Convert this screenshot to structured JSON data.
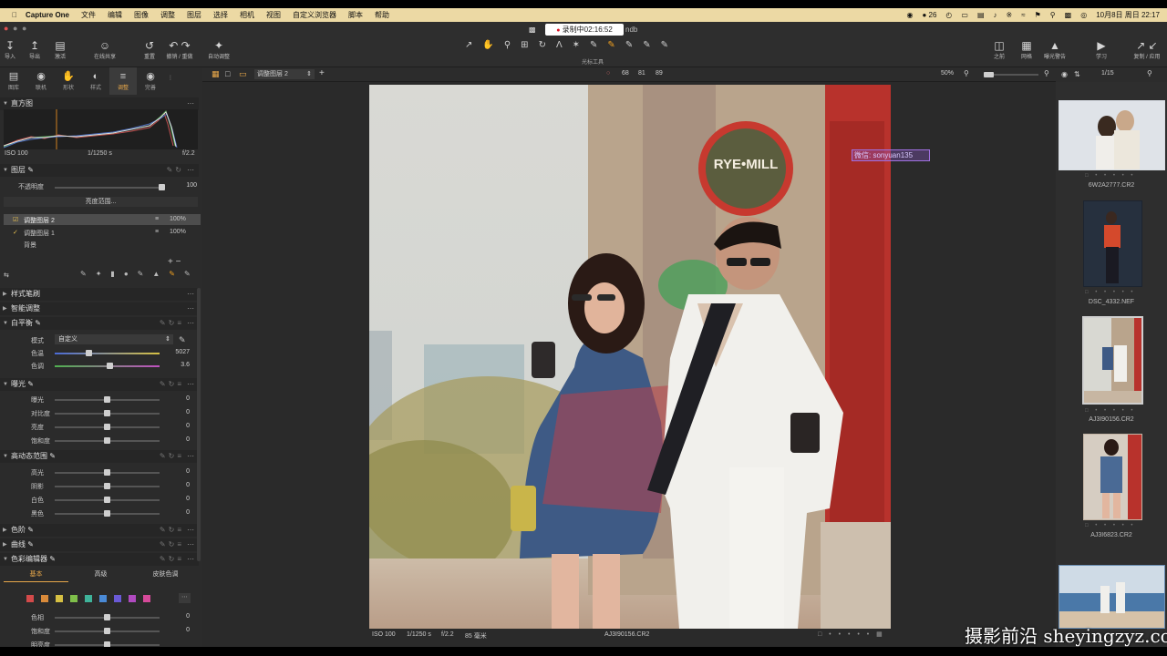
{
  "menubar": {
    "app": "Capture One",
    "items": [
      "文件",
      "编辑",
      "图像",
      "调整",
      "图层",
      "选择",
      "相机",
      "视图",
      "自定义浏览器",
      "脚本",
      "帮助"
    ],
    "battery": "26",
    "datetime": "10月8日 周日  22:17"
  },
  "recording": {
    "label": "录制中02:16:52",
    "suffix": "ndb"
  },
  "toolbar": {
    "left": [
      {
        "icon": "import-icon",
        "label": "导入"
      },
      {
        "icon": "export-icon",
        "label": "导出"
      },
      {
        "icon": "process-icon",
        "label": "激活"
      },
      {
        "icon": "share-icon",
        "label": "在线共享"
      },
      {
        "icon": "reset-icon",
        "label": "重置"
      },
      {
        "icon": "undo-icon",
        "label": "撤销 / 重做"
      },
      {
        "icon": "auto-adjust-icon",
        "label": "自动调整"
      }
    ],
    "center_label": "光标工具",
    "right": [
      {
        "icon": "before-icon",
        "label": "之前"
      },
      {
        "icon": "grid-icon",
        "label": "网格"
      },
      {
        "icon": "exposure-warning-icon",
        "label": "曝光警告"
      },
      {
        "icon": "learn-icon",
        "label": "学习"
      },
      {
        "icon": "copy-apply-icon",
        "label": "复制 / 应用"
      }
    ]
  },
  "tools_tabs": [
    {
      "icon": "library-icon",
      "label": "图库"
    },
    {
      "icon": "capture-icon",
      "label": "联机"
    },
    {
      "icon": "lens-icon",
      "label": "形状"
    },
    {
      "icon": "color-icon",
      "label": "样式"
    },
    {
      "icon": "adjust-icon",
      "label": "调整"
    },
    {
      "icon": "details-icon",
      "label": "完善"
    }
  ],
  "histogram": {
    "title": "直方图",
    "iso": "ISO 100",
    "shutter": "1/1250 s",
    "aperture": "f/2.2"
  },
  "layers": {
    "title": "图层",
    "opacity_label": "不透明度",
    "opacity_value": "100",
    "brightness_button": "亮度范围...",
    "items": [
      {
        "name": "调整图层 2",
        "value": "100%",
        "selected": true
      },
      {
        "name": "调整图层 1",
        "value": "100%",
        "selected": false
      },
      {
        "name": "背景",
        "value": "",
        "selected": false
      }
    ]
  },
  "sections": {
    "style_brush": "样式笔刷",
    "smart_adjust": "智能调整",
    "white_balance": "白平衡",
    "wb_mode_label": "模式",
    "wb_mode_value": "自定义",
    "wb_kelvin_label": "色温",
    "wb_kelvin_value": "5027",
    "wb_tint_label": "色调",
    "wb_tint_value": "3.6",
    "exposure": "曝光",
    "exposure_rows": [
      {
        "label": "曝光",
        "value": "0"
      },
      {
        "label": "对比度",
        "value": "0"
      },
      {
        "label": "亮度",
        "value": "0"
      },
      {
        "label": "饱和度",
        "value": "0"
      }
    ],
    "hdr": "高动态范围",
    "hdr_rows": [
      {
        "label": "高光",
        "value": "0"
      },
      {
        "label": "阴影",
        "value": "0"
      },
      {
        "label": "白色",
        "value": "0"
      },
      {
        "label": "黑色",
        "value": "0"
      }
    ],
    "levels": "色阶",
    "curve": "曲线",
    "color_editor": "色彩编辑器",
    "ce_tabs": [
      "基本",
      "高级",
      "皮肤色调"
    ],
    "ce_rows": [
      {
        "label": "色相",
        "value": "0"
      },
      {
        "label": "饱和度",
        "value": "0"
      },
      {
        "label": "明亮度",
        "value": ""
      }
    ],
    "swatch_colors": [
      "#d34a4a",
      "#d98a3a",
      "#d6c043",
      "#7fbf4a",
      "#3fb39a",
      "#4a8ad6",
      "#6a5ad6",
      "#b04ac0",
      "#d64a9a"
    ]
  },
  "viewer": {
    "layer_select": "调整图层 2",
    "readout": [
      "68",
      "81",
      "89"
    ],
    "zoom": "50%",
    "counter": "1/15",
    "overlay_text": "微信: sonyuan135"
  },
  "photo_status": {
    "iso": "ISO 100",
    "shutter": "1/1250 s",
    "aperture": "f/2.2",
    "focal": "85 毫米",
    "filename": "AJ3I9015​6.CR2"
  },
  "filmstrip": [
    {
      "name": "6W2A2777.CR2"
    },
    {
      "name": "DSC_4332.NEF"
    },
    {
      "name": "AJ3I9015​6.CR2",
      "selected": true
    },
    {
      "name": "AJ3I6823.CR2"
    }
  ],
  "watermark": "摄影前沿 sheyingzyz.com"
}
